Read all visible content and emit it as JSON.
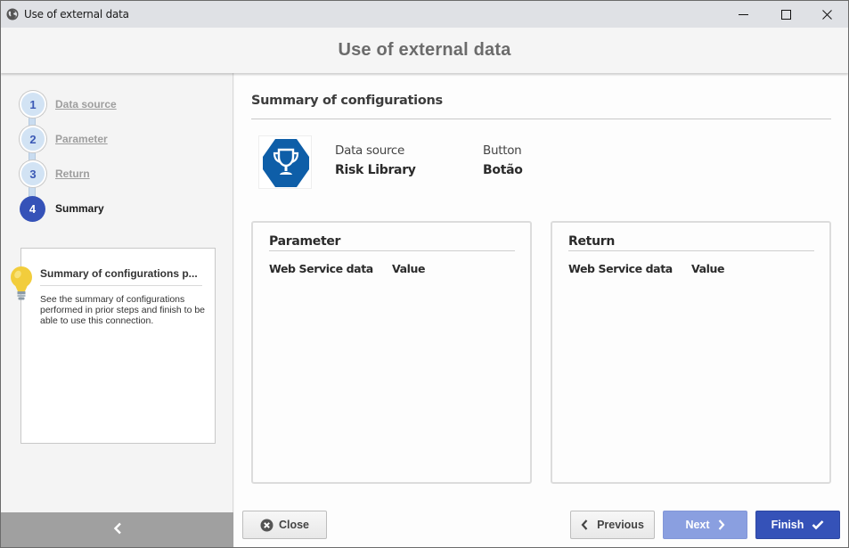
{
  "window": {
    "title": "Use of external data",
    "app_icon": "globe-icon",
    "controls": [
      "minimize-icon",
      "maximize-icon",
      "close-icon"
    ]
  },
  "header": {
    "title": "Use of external data"
  },
  "sidebar": {
    "steps": [
      {
        "number": "1",
        "label": "Data source",
        "state": "completed"
      },
      {
        "number": "2",
        "label": "Parameter",
        "state": "completed"
      },
      {
        "number": "3",
        "label": "Return",
        "state": "completed"
      },
      {
        "number": "4",
        "label": "Summary",
        "state": "active"
      }
    ],
    "help": {
      "icon": "lightbulb-icon",
      "title": "Summary of configurations p...",
      "text": "See the summary of configurations performed in prior steps and finish to be able to use this connection."
    },
    "collapse_icon": "chevron-left-icon"
  },
  "main": {
    "section_title": "Summary of configurations",
    "data_source_icon": "trophy-icon",
    "data_source_label": "Data source",
    "data_source_value": "Risk Library",
    "button_label": "Button",
    "button_value": "Botão",
    "panels": [
      {
        "title": "Parameter",
        "columns": [
          "Web Service data",
          "Value"
        ],
        "rows": []
      },
      {
        "title": "Return",
        "columns": [
          "Web Service data",
          "Value"
        ],
        "rows": []
      }
    ]
  },
  "footer": {
    "close_label": "Close",
    "previous_label": "Previous",
    "next_label": "Next",
    "finish_label": "Finish"
  },
  "colors": {
    "accent": "#3552b8",
    "accent_disabled": "#8a9fe0",
    "step_completed_bg": "#d2e3f4",
    "data_source_icon_bg": "#0e5ea8"
  }
}
